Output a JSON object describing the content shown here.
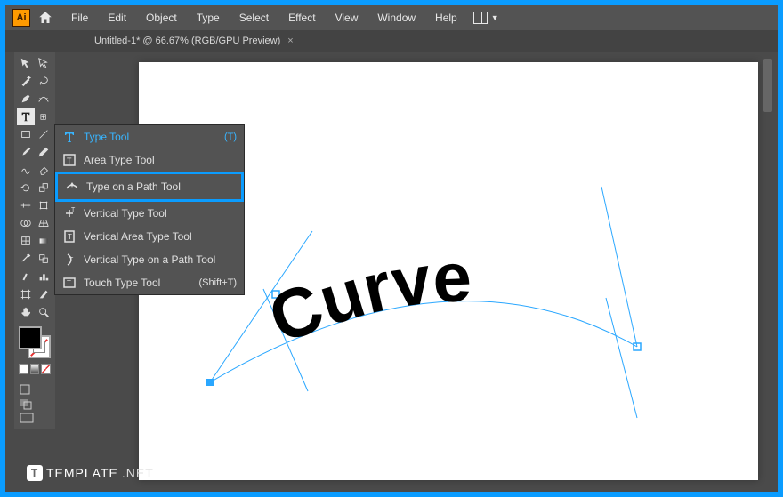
{
  "menubar": {
    "logo": "Ai",
    "items": [
      "File",
      "Edit",
      "Object",
      "Type",
      "Select",
      "Effect",
      "View",
      "Window",
      "Help"
    ]
  },
  "tab": {
    "title": "Untitled-1* @ 66.67% (RGB/GPU Preview)"
  },
  "toolbar": {
    "label": ""
  },
  "type_flyout": {
    "options": [
      {
        "label": "Type Tool",
        "shortcut": "(T)",
        "highlight": true
      },
      {
        "label": "Area Type Tool",
        "shortcut": ""
      },
      {
        "label": "Type on a Path Tool",
        "shortcut": "",
        "selected": true
      },
      {
        "label": "Vertical Type Tool",
        "shortcut": ""
      },
      {
        "label": "Vertical Area Type Tool",
        "shortcut": ""
      },
      {
        "label": "Vertical Type on a Path Tool",
        "shortcut": ""
      },
      {
        "label": "Touch Type Tool",
        "shortcut": "(Shift+T)"
      }
    ]
  },
  "canvas": {
    "text": "Curve"
  },
  "watermark": {
    "brand": "TEMPLATE",
    "suffix": ".NET"
  }
}
